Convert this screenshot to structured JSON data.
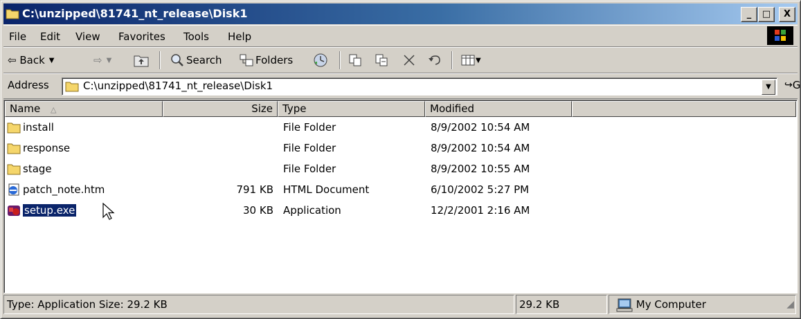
{
  "window": {
    "title": "C:\\unzipped\\81741_nt_release\\Disk1",
    "minimize": "_",
    "maximize": "□",
    "close": "X"
  },
  "menu": [
    "File",
    "Edit",
    "View",
    "Favorites",
    "Tools",
    "Help"
  ],
  "toolbar": {
    "back_label": "Back",
    "search_label": "Search",
    "folders_label": "Folders"
  },
  "address": {
    "label": "Address",
    "value": "C:\\unzipped\\81741_nt_release\\Disk1",
    "go_label": "Go"
  },
  "columns": {
    "name": "Name",
    "size": "Size",
    "type": "Type",
    "modified": "Modified"
  },
  "files": [
    {
      "name": "install",
      "size": "",
      "type": "File Folder",
      "modified": "8/9/2002 10:54 AM",
      "icon": "folder-icon"
    },
    {
      "name": "response",
      "size": "",
      "type": "File Folder",
      "modified": "8/9/2002 10:54 AM",
      "icon": "folder-icon"
    },
    {
      "name": "stage",
      "size": "",
      "type": "File Folder",
      "modified": "8/9/2002 10:55 AM",
      "icon": "folder-icon"
    },
    {
      "name": "patch_note.htm",
      "size": "791 KB",
      "type": "HTML Document",
      "modified": "6/10/2002 5:27 PM",
      "icon": "html-document-icon"
    },
    {
      "name": "setup.exe",
      "size": "30 KB",
      "type": "Application",
      "modified": "12/2/2001 2:16 AM",
      "icon": "application-icon",
      "selected": true
    }
  ],
  "status": {
    "info": "Type: Application Size: 29.2 KB",
    "size": "29.2 KB",
    "zone": "My Computer"
  },
  "colors": {
    "title_start": "#0a246a",
    "title_end": "#a6caf0",
    "selection": "#0a246a",
    "chrome": "#d4d0c8"
  }
}
